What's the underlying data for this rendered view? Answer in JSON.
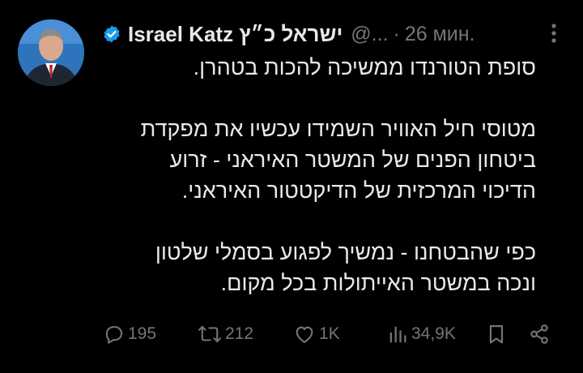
{
  "author": {
    "display_name": "Israel Katz ישראל כ״ץ",
    "handle": "@...",
    "separator": "·",
    "time": "26 мин.",
    "verified": true,
    "avatar_icon": "portrait-photo"
  },
  "tweet": {
    "paragraphs": [
      {
        "lines": [
          "סופת הטורנדו ממשיכה להכות בטהרן."
        ]
      },
      {
        "lines": [
          "מטוסי חיל האוויר השמידו עכשיו את מפקדת",
          "ביטחון הפנים של המשטר האיראני - זרוע",
          "הדיכוי המרכזית של הדיקטטור האיראני."
        ]
      },
      {
        "lines": [
          "כפי שהבטחנו - נמשיך לפגוע בסמלי שלטון",
          "ונכה במשטר האייתולות בכל מקום."
        ]
      }
    ]
  },
  "actions": {
    "replies": "195",
    "reposts": "212",
    "likes": "1K",
    "views": "34,9K",
    "reply_icon": "reply-icon",
    "repost_icon": "repost-icon",
    "like_icon": "heart-icon",
    "views_icon": "bar-chart-icon",
    "bookmark_icon": "bookmark-icon",
    "share_icon": "share-icon"
  },
  "colors": {
    "background": "#000000",
    "text": "#e7e9ea",
    "secondary": "#71767b",
    "verified": "#1d9bf0"
  }
}
